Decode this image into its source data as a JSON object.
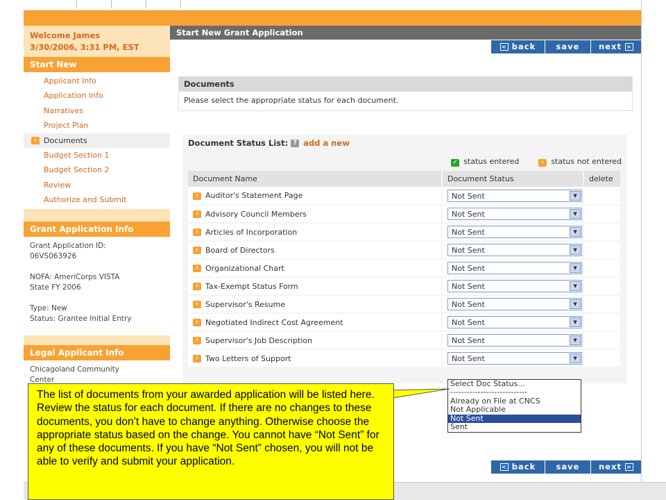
{
  "sidebar": {
    "welcome_name": "Welcome James",
    "welcome_date": "3/30/2006, 3:31 PM, EST",
    "start_new_title": "Start New",
    "nav_items": [
      {
        "label": "Applicant Info"
      },
      {
        "label": "Application Info"
      },
      {
        "label": "Narratives"
      },
      {
        "label": "Project Plan"
      },
      {
        "label": "Documents"
      },
      {
        "label": "Budget Section 1"
      },
      {
        "label": "Budget Section 2"
      },
      {
        "label": "Review"
      },
      {
        "label": "Authorize and Submit"
      }
    ],
    "grant_info_title": "Grant Application Info",
    "grant_id_label": "Grant Application ID:",
    "grant_id_value": "06VS063926",
    "nofa_line1": "NOFA: AmeriCorps VISTA",
    "nofa_line2": "State FY 2006",
    "type_line": "Type: New",
    "status_line": "Status: Grantee Initial Entry",
    "legal_title": "Legal Applicant Info",
    "legal_name_line1": "Chicagoland Community",
    "legal_name_line2": "Center"
  },
  "main": {
    "title": "Start New Grant Application",
    "buttons": {
      "back": "back",
      "save": "save",
      "next": "next"
    },
    "documents_header": "Documents",
    "documents_description": "Please select the appropriate status for each document.",
    "list_title": "Document Status List:",
    "help_icon": "?",
    "add_new": "add a new",
    "legend_entered": "status entered",
    "legend_not_entered": "status not entered",
    "columns": {
      "name": "Document Name",
      "status": "Document Status",
      "delete": "delete"
    },
    "rows": [
      {
        "name": "Auditor's Statement Page",
        "status": "Not Sent"
      },
      {
        "name": "Advisory Council Members",
        "status": "Not Sent"
      },
      {
        "name": "Articles of Incorporation",
        "status": "Not Sent"
      },
      {
        "name": "Board of Directors",
        "status": "Not Sent"
      },
      {
        "name": "Organizational Chart",
        "status": "Not Sent"
      },
      {
        "name": "Tax-Exempt Status Form",
        "status": "Not Sent"
      },
      {
        "name": "Supervisor's Resume",
        "status": "Not Sent"
      },
      {
        "name": "Negotiated Indirect Cost Agreement",
        "status": "Not Sent"
      },
      {
        "name": "Supervisor's Job Description",
        "status": "Not Sent"
      },
      {
        "name": "Two Letters of Support",
        "status": "Not Sent"
      }
    ],
    "dropdown_options": [
      "Select Doc Status...",
      "----------------------------",
      "Already on File at CNCS",
      "Not Applicable",
      "Not Sent",
      "Sent"
    ],
    "dropdown_selected_index": 4
  },
  "callout": {
    "text": "The list of documents from your awarded application will be listed here.  Review the status for each document.  If there are no changes to these documents, you don’t have to change anything.  Otherwise choose the appropriate status based on the change. You cannot have “Not Sent” for any of these documents.  If you have “Not Sent” chosen, you will not be able to verify and submit your application."
  },
  "colors": {
    "orange": "#f7a233",
    "light_orange": "#fde4b8",
    "nav_text": "#d2691e",
    "button_blue": "#2e68a8",
    "title_gray": "#6b6b6b",
    "callout_yellow": "#ffff00",
    "dropdown_selected": "#2a4f9c"
  }
}
